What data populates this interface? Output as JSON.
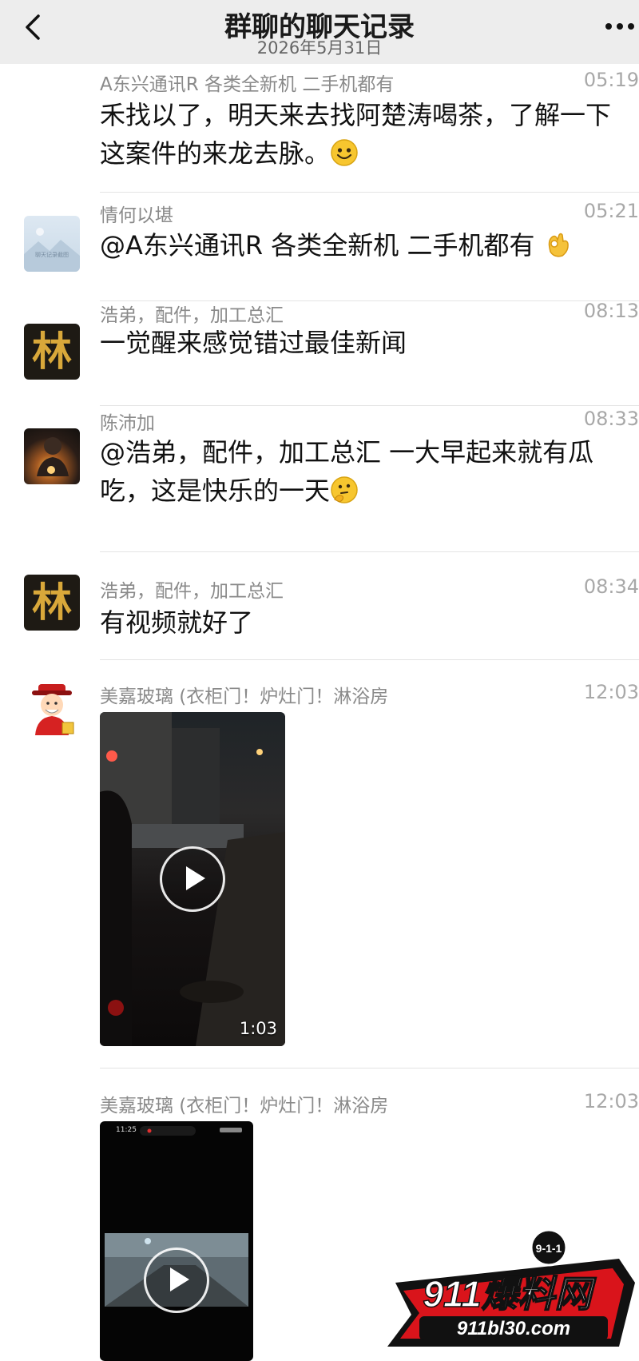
{
  "header": {
    "title": "群聊的聊天记录",
    "date": "2026年5月31日"
  },
  "messages": [
    {
      "sender": "A东兴通讯R 各类全新机 二手机都有",
      "time": "05:19",
      "line1": "禾找以了，明天来去找阿楚涛喝茶，了解一下",
      "line2": "这案件的来龙去脉。"
    },
    {
      "sender": "情何以堪",
      "time": "05:21",
      "text": "@A东兴通讯R 各类全新机 二手机都有",
      "avatar_text": "聊天记录截图"
    },
    {
      "sender": "浩弟，配件，加工总汇",
      "time": "08:13",
      "text": "一觉醒来感觉错过最佳新闻",
      "avatar_char": "林"
    },
    {
      "sender": "陈沛加",
      "time": "08:33",
      "line1": "@浩弟，配件，加工总汇 一大早起来就有瓜",
      "line2": "吃，这是快乐的一天"
    },
    {
      "sender": "浩弟，配件，加工总汇",
      "time": "08:34",
      "text": "有视频就好了",
      "avatar_char": "林"
    },
    {
      "sender": "美嘉玻璃 (衣柜门！炉灶门！淋浴房",
      "time": "12:03",
      "video_duration": "1:03"
    },
    {
      "sender": "美嘉玻璃 (衣柜门！炉灶门！淋浴房",
      "time": "12:03",
      "phone_time": "11:25"
    }
  ],
  "watermark": {
    "badge": "9-1-1",
    "name": "911爆料网",
    "url": "911bl30.com"
  },
  "colors": {
    "header_bg": "#ededed",
    "text": "#111111",
    "meta": "#8a8a8a",
    "separator": "#e4e4e4",
    "watermark_red": "#d9141b"
  }
}
